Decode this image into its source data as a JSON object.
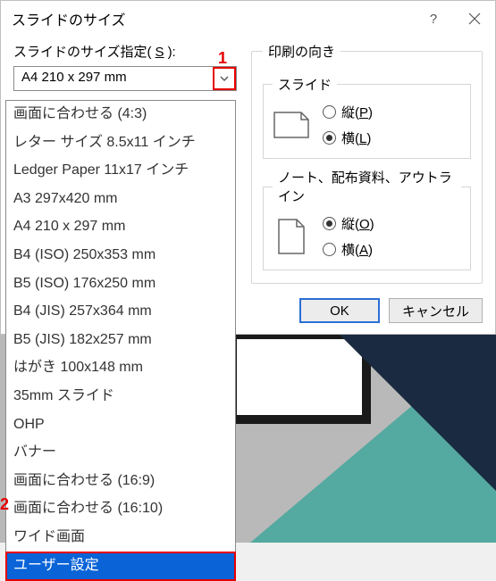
{
  "dialog": {
    "title": "スライドのサイズ",
    "size_label_prefix": "スライドのサイズ指定(",
    "size_label_accel": "S",
    "size_label_suffix": "):",
    "combo_value": "A4 210 x 297 mm",
    "options": [
      "画面に合わせる (4:3)",
      "レター サイズ 8.5x11 インチ",
      "Ledger Paper 11x17 インチ",
      "A3 297x420 mm",
      "A4 210 x 297 mm",
      "B4 (ISO) 250x353 mm",
      "B5 (ISO) 176x250 mm",
      "B4 (JIS) 257x364 mm",
      "B5 (JIS) 182x257 mm",
      "はがき 100x148 mm",
      "35mm スライド",
      "OHP",
      "バナー",
      "画面に合わせる (16:9)",
      "画面に合わせる (16:10)",
      "ワイド画面",
      "ユーザー設定"
    ],
    "selected_index": 16,
    "orientation": {
      "group_label": "印刷の向き",
      "slide": {
        "label": "スライド",
        "portrait_pre": "縦(",
        "portrait_acc": "P",
        "portrait_suf": ")",
        "landscape_pre": "横(",
        "landscape_acc": "L",
        "landscape_suf": ")",
        "value": "landscape"
      },
      "notes": {
        "label": "ノート、配布資料、アウトライン",
        "portrait_pre": "縦(",
        "portrait_acc": "O",
        "portrait_suf": ")",
        "landscape_pre": "横(",
        "landscape_acc": "A",
        "landscape_suf": ")",
        "value": "portrait"
      }
    },
    "buttons": {
      "ok": "OK",
      "cancel": "キャンセル"
    }
  },
  "annotations": {
    "one": "1",
    "two": "2"
  },
  "help_glyph": "?",
  "bg": {
    "teal": "#54a9a0",
    "navy": "#1a2a40",
    "black": "#1a1a1a"
  }
}
